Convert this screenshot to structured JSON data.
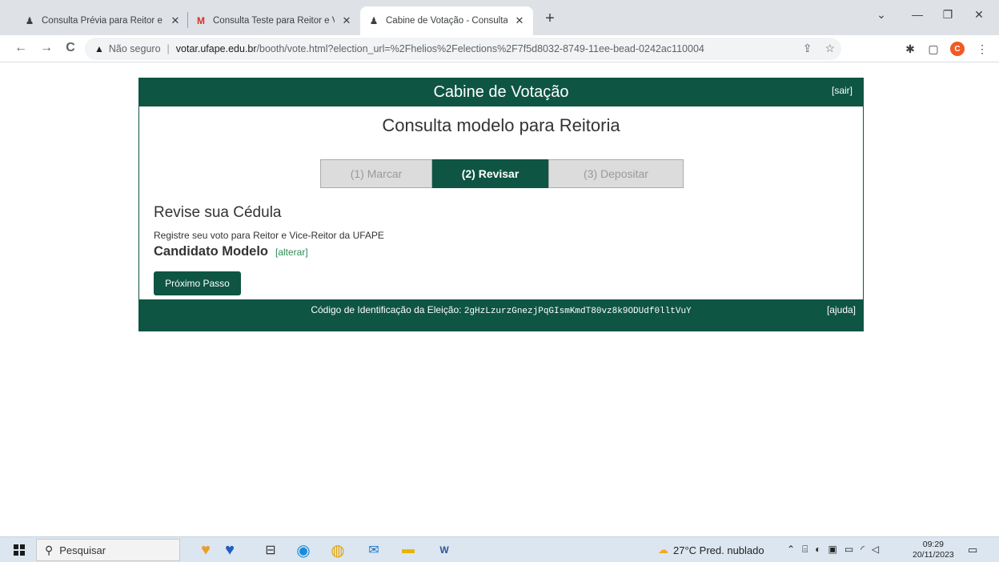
{
  "browser": {
    "tabs": [
      {
        "title": "Consulta Prévia para Reitor e Vic",
        "close": "✕"
      },
      {
        "title": "Consulta Teste para Reitor e Vice",
        "close": "✕"
      },
      {
        "title": "Cabine de Votação - Consulta m",
        "close": "✕"
      }
    ],
    "new_tab": "+",
    "window_controls": {
      "dropdown": "⌄",
      "minimize": "—",
      "restore": "❐",
      "close": "✕"
    },
    "nav": {
      "back": "←",
      "forward": "→",
      "reload": "C"
    },
    "address": {
      "warning_icon": "▲",
      "security_label": "Não seguro",
      "separator": "|",
      "host": "votar.ufape.edu.br",
      "path": "/booth/vote.html?election_url=%2Fhelios%2Felections%2F7f5d8032-8749-11ee-bead-0242ac110004"
    },
    "profile_initial": "C"
  },
  "booth": {
    "title": "Cabine de Votação",
    "logout": "[sair]",
    "election_name": "Consulta modelo para Reitoria",
    "steps": [
      {
        "label": "(1) Marcar"
      },
      {
        "label": "(2) Revisar"
      },
      {
        "label": "(3) Depositar"
      }
    ],
    "review_title": "Revise sua Cédula",
    "question": "Registre seu voto para Reitor e Vice-Reitor da UFAPE",
    "selected_candidate": "Candidato Modelo",
    "change_link": "[alterar]",
    "next_button": "Próximo Passo",
    "footer_label": "Código de Identificação da Eleição:",
    "footer_code": "2gHzLzurzGnezjPqGIsmKmdT80vz8k9ODUdf0lltVuY",
    "help": "[ajuda]"
  },
  "taskbar": {
    "search_placeholder": "Pesquisar",
    "weather": "27°C  Pred. nublado",
    "time": "09:29",
    "date": "20/11/2023"
  },
  "colors": {
    "brand_green": "#0e5543",
    "link_green": "#2e8b57"
  }
}
